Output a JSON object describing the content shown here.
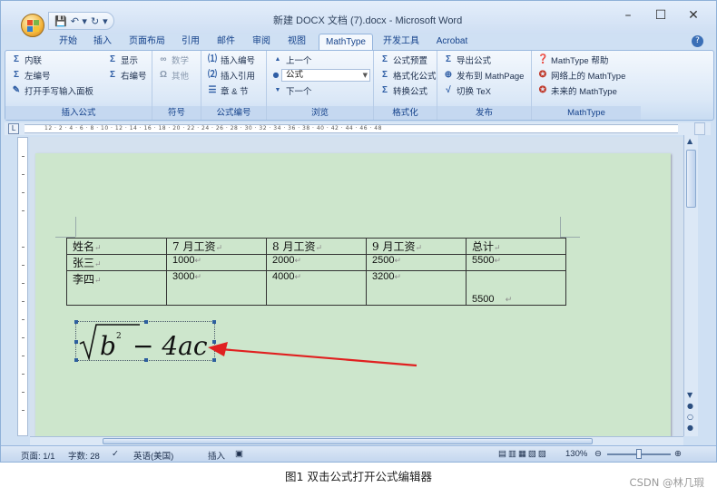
{
  "window": {
    "title": "新建 DOCX 文档 (7).docx - Microsoft Word",
    "controls": [
      "–",
      "☐",
      "✕"
    ]
  },
  "qat": {
    "save": "💾",
    "undo": "↶ ▾",
    "redo": "↻",
    "more": "▾"
  },
  "tabs": [
    {
      "label": "开始",
      "active": false
    },
    {
      "label": "插入",
      "active": false
    },
    {
      "label": "页面布局",
      "active": false
    },
    {
      "label": "引用",
      "active": false
    },
    {
      "label": "邮件",
      "active": false
    },
    {
      "label": "审阅",
      "active": false
    },
    {
      "label": "视图",
      "active": false
    },
    {
      "label": "MathType",
      "active": true
    },
    {
      "label": "开发工具",
      "active": false
    },
    {
      "label": "Acrobat",
      "active": false
    }
  ],
  "ribbon": {
    "insert_formula": {
      "label": "插入公式",
      "inline": "内联",
      "display": "显示",
      "left_number": "左编号",
      "right_number": "右编号",
      "handwriting": "打开手写输入面板"
    },
    "symbols": {
      "label": "符号",
      "math": "数学",
      "other": "其他"
    },
    "numbering": {
      "label": "公式编号",
      "insert_number": "插入编号",
      "insert_ref": "插入引用",
      "chapter": "章 & 节"
    },
    "browse": {
      "label": "浏览",
      "prev": "上一个",
      "combo": "公式",
      "next": "下一个"
    },
    "format": {
      "label": "格式化",
      "preset": "公式预置",
      "format_formula": "格式化公式",
      "convert": "转换公式"
    },
    "publish": {
      "label": "发布",
      "export": "导出公式",
      "publish_mathpage": "发布到 MathPage",
      "toggle_tex": "切换 TeX"
    },
    "mathtype": {
      "label": "MathType",
      "help": "MathType 帮助",
      "online": "网络上的 MathType",
      "future": "未来的 MathType"
    }
  },
  "ruler": {
    "corner": "L",
    "text": "12  ·  2  ·  4  ·  6  ·  8  ·  10 ·  12 ·  14 ·  16 ·  18 ·  20 ·  22 ·  24 ·  26 ·  28 ·  30 ·  32 ·  34 ·  36 ·  38 ·  40 ·  42 ·  44 ·  46 ·  48"
  },
  "table": {
    "headers": [
      "姓名",
      "7 月工资",
      "8 月工资",
      "9 月工资",
      "总计"
    ],
    "rows": [
      [
        "张三",
        "1000",
        "2000",
        "2500",
        "5500"
      ],
      [
        "李四",
        "3000",
        "4000",
        "3200",
        "5500"
      ]
    ],
    "para_mark": "↵"
  },
  "formula": {
    "b": "b",
    "exp": "2",
    "rest": "− 4ac"
  },
  "annotation_arrow_color": "#e02020",
  "statusbar": {
    "page": "页面: 1/1",
    "words": "字数: 28",
    "language": "英语(美国)",
    "mode": "插入",
    "zoom": "130%"
  },
  "caption": "图1 双击公式打开公式编辑器",
  "watermark": "CSDN @林几瑕"
}
